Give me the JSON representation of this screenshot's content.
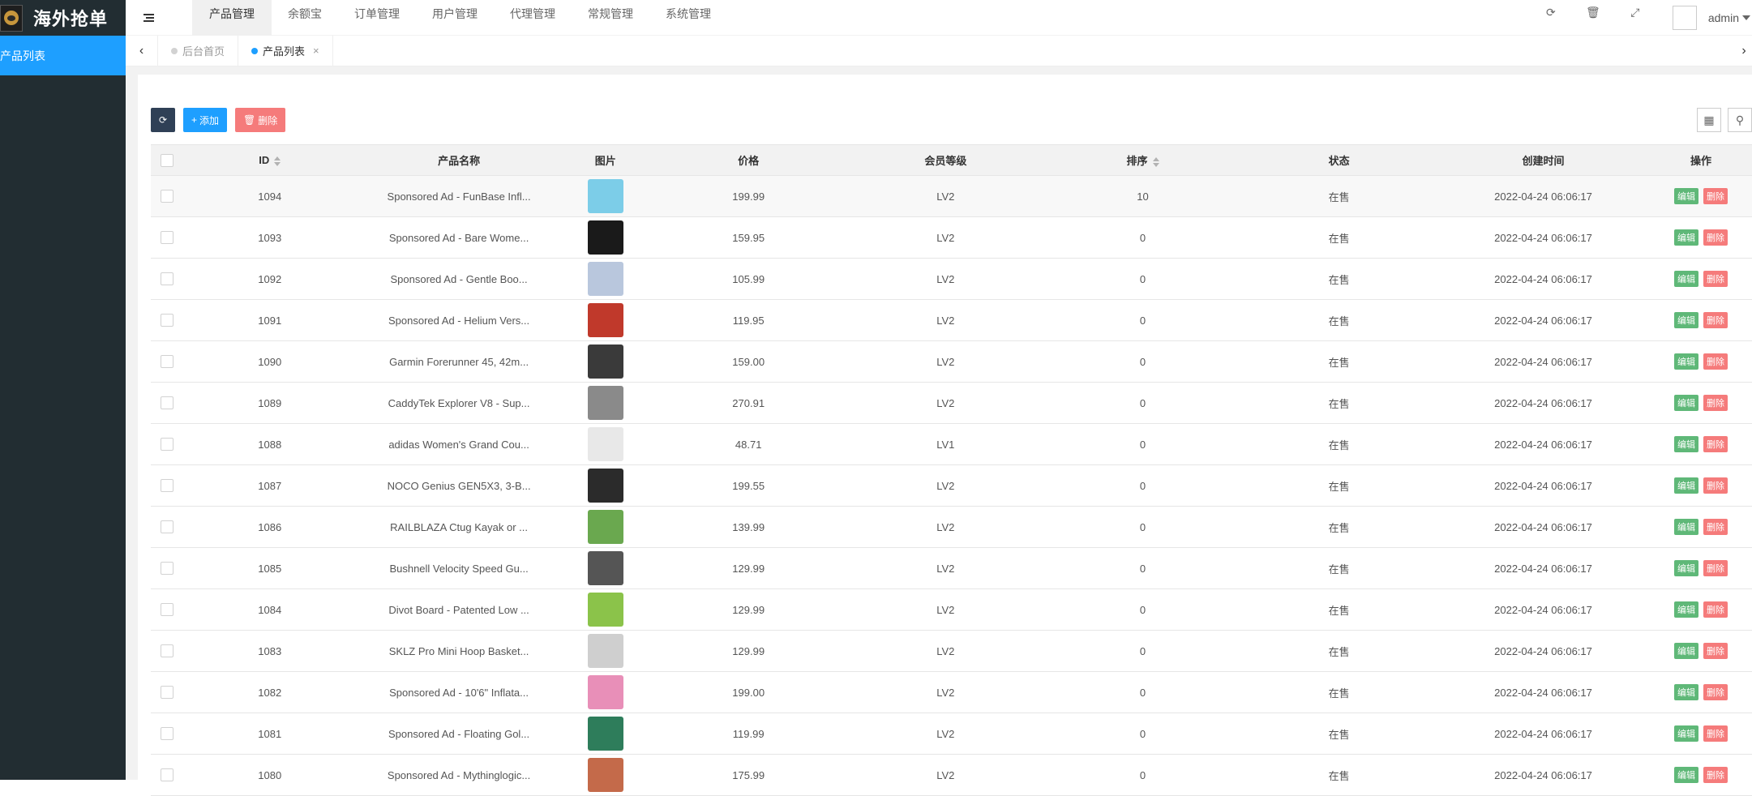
{
  "app": {
    "title": "海外抢单"
  },
  "sidebar": {
    "items": [
      {
        "label": "产品列表"
      }
    ]
  },
  "header": {
    "nav": [
      {
        "label": "产品管理"
      },
      {
        "label": "余额宝"
      },
      {
        "label": "订单管理"
      },
      {
        "label": "用户管理"
      },
      {
        "label": "代理管理"
      },
      {
        "label": "常规管理"
      },
      {
        "label": "系统管理"
      }
    ],
    "right_icons": [
      "refresh-icon",
      "trash-icon",
      "fullscreen-icon"
    ],
    "user": "admin"
  },
  "tabs": [
    {
      "label": "后台首页"
    },
    {
      "label": "产品列表"
    }
  ],
  "toolbar": {
    "add": "添加",
    "delete": "删除"
  },
  "table": {
    "headers": [
      "ID",
      "产品名称",
      "图片",
      "价格",
      "会员等级",
      "排序",
      "状态",
      "创建时间",
      "操作"
    ],
    "actions": {
      "edit": "编辑",
      "delete": "删除"
    },
    "rows": [
      {
        "id": "1094",
        "name": "Sponsored Ad - FunBase Infl...",
        "price": "199.99",
        "level": "LV2",
        "sort": "10",
        "status": "在售",
        "created": "2022-04-24 06:06:17",
        "thumb": "#7ccde8"
      },
      {
        "id": "1093",
        "name": "Sponsored Ad - Bare Wome...",
        "price": "159.95",
        "level": "LV2",
        "sort": "0",
        "status": "在售",
        "created": "2022-04-24 06:06:17",
        "thumb": "#1a1a1a"
      },
      {
        "id": "1092",
        "name": "Sponsored Ad - Gentle Boo...",
        "price": "105.99",
        "level": "LV2",
        "sort": "0",
        "status": "在售",
        "created": "2022-04-24 06:06:17",
        "thumb": "#b9c7dd"
      },
      {
        "id": "1091",
        "name": "Sponsored Ad - Helium Vers...",
        "price": "119.95",
        "level": "LV2",
        "sort": "0",
        "status": "在售",
        "created": "2022-04-24 06:06:17",
        "thumb": "#c0392b"
      },
      {
        "id": "1090",
        "name": "Garmin Forerunner 45, 42m...",
        "price": "159.00",
        "level": "LV2",
        "sort": "0",
        "status": "在售",
        "created": "2022-04-24 06:06:17",
        "thumb": "#3a3a3a"
      },
      {
        "id": "1089",
        "name": "CaddyTek Explorer V8 - Sup...",
        "price": "270.91",
        "level": "LV2",
        "sort": "0",
        "status": "在售",
        "created": "2022-04-24 06:06:17",
        "thumb": "#8a8a8a"
      },
      {
        "id": "1088",
        "name": "adidas Women's Grand Cou...",
        "price": "48.71",
        "level": "LV1",
        "sort": "0",
        "status": "在售",
        "created": "2022-04-24 06:06:17",
        "thumb": "#e8e8e8"
      },
      {
        "id": "1087",
        "name": "NOCO Genius GEN5X3, 3-B...",
        "price": "199.55",
        "level": "LV2",
        "sort": "0",
        "status": "在售",
        "created": "2022-04-24 06:06:17",
        "thumb": "#2b2b2b"
      },
      {
        "id": "1086",
        "name": "RAILBLAZA Ctug Kayak or ...",
        "price": "139.99",
        "level": "LV2",
        "sort": "0",
        "status": "在售",
        "created": "2022-04-24 06:06:17",
        "thumb": "#6aa84f"
      },
      {
        "id": "1085",
        "name": "Bushnell Velocity Speed Gu...",
        "price": "129.99",
        "level": "LV2",
        "sort": "0",
        "status": "在售",
        "created": "2022-04-24 06:06:17",
        "thumb": "#555555"
      },
      {
        "id": "1084",
        "name": "Divot Board - Patented Low ...",
        "price": "129.99",
        "level": "LV2",
        "sort": "0",
        "status": "在售",
        "created": "2022-04-24 06:06:17",
        "thumb": "#8bc34a"
      },
      {
        "id": "1083",
        "name": "SKLZ Pro Mini Hoop Basket...",
        "price": "129.99",
        "level": "LV2",
        "sort": "0",
        "status": "在售",
        "created": "2022-04-24 06:06:17",
        "thumb": "#cfcfcf"
      },
      {
        "id": "1082",
        "name": "Sponsored Ad - 10'6\" Inflata...",
        "price": "199.00",
        "level": "LV2",
        "sort": "0",
        "status": "在售",
        "created": "2022-04-24 06:06:17",
        "thumb": "#e88fb8"
      },
      {
        "id": "1081",
        "name": "Sponsored Ad - Floating Gol...",
        "price": "119.99",
        "level": "LV2",
        "sort": "0",
        "status": "在售",
        "created": "2022-04-24 06:06:17",
        "thumb": "#2e7d5b"
      },
      {
        "id": "1080",
        "name": "Sponsored Ad - Mythinglogic...",
        "price": "175.99",
        "level": "LV2",
        "sort": "0",
        "status": "在售",
        "created": "2022-04-24 06:06:17",
        "thumb": "#c46a4a"
      }
    ]
  }
}
